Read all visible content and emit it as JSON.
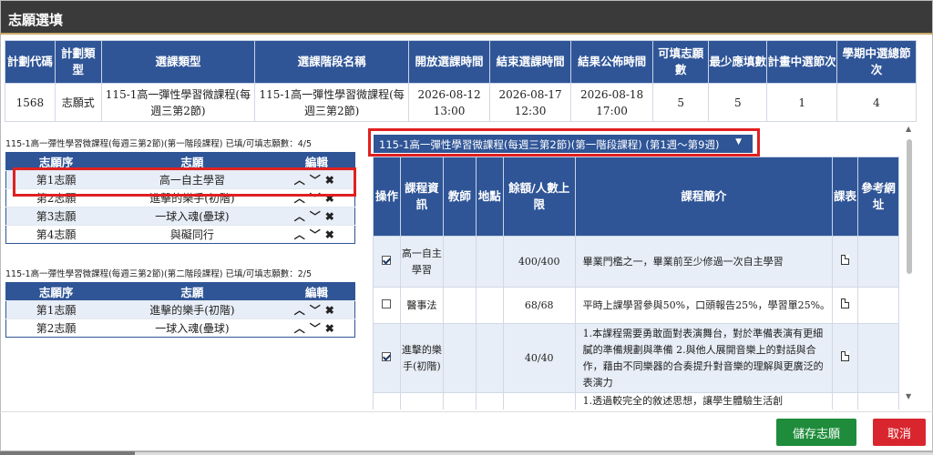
{
  "modal": {
    "title": "志願選填"
  },
  "plan": {
    "headers": [
      "計劃代碼",
      "計劃類型",
      "選課類型",
      "選課階段名稱",
      "開放選課時間",
      "結束選課時間",
      "結果公佈時間",
      "可填志願數",
      "最少應填數",
      "計畫中選節次",
      "學期中選總節次"
    ],
    "row": [
      "1568",
      "志願式",
      "115-1高一彈性學習微課程(每週三第2節)",
      "115-1高一彈性學習微課程(每週三第2節)",
      "2026-08-12 13:00",
      "2026-08-17 12:30",
      "2026-08-18 17:00",
      "5",
      "5",
      "1",
      "4"
    ]
  },
  "wishlist1": {
    "caption": "115-1高一彈性學習微課程(每週三第2節)(第一階段課程) 已填/可填志願數：4/5",
    "headers": [
      "志願序",
      "志願",
      "編輯"
    ],
    "rows": [
      {
        "order": "第1志願",
        "course": "高一自主學習"
      },
      {
        "order": "第2志願",
        "course": "進擊的樂手(初階)"
      },
      {
        "order": "第3志願",
        "course": "一球入魂(壘球)"
      },
      {
        "order": "第4志願",
        "course": "與礙同行"
      }
    ]
  },
  "wishlist2": {
    "caption": "115-1高一彈性學習微課程(每週三第2節)(第二階段課程) 已填/可填志願數：2/5",
    "headers": [
      "志願序",
      "志願",
      "編輯"
    ],
    "rows": [
      {
        "order": "第1志願",
        "course": "進擊的樂手(初階)"
      },
      {
        "order": "第2志願",
        "course": "一球入魂(壘球)"
      }
    ]
  },
  "edit_icons": {
    "up": "chevron-up-icon",
    "down": "chevron-down-icon",
    "remove": "close-icon"
  },
  "phase_select": {
    "value": "115-1高一彈性學習微課程(每週三第2節)(第一階段課程) (第1週～第9週)"
  },
  "courses": {
    "headers": [
      "操作",
      "課程資訊",
      "教師",
      "地點",
      "餘額/人數上限",
      "課程簡介",
      "課表",
      "參考網址"
    ],
    "rows": [
      {
        "checked": true,
        "name": "高一自主學習",
        "teacher": "",
        "location": "",
        "quota": "400/400",
        "intro": "畢業門檻之一，畢業前至少修過一次自主學習"
      },
      {
        "checked": false,
        "name": "醫事法",
        "teacher": "",
        "location": "",
        "quota": "68/68",
        "intro": "平時上課學習參與50%，口頭報告25%，學習單25%。"
      },
      {
        "checked": true,
        "name": "進擊的樂手(初階)",
        "teacher": "",
        "location": "",
        "quota": "40/40",
        "intro": "1.本課程需要勇敢面對表演舞台，對於準備表演有更細膩的準備規劃與準備 2.與他人展開音樂上的對話與合作，藉由不同樂器的合奏提升對音樂的理解與更廣泛的表演力"
      },
      {
        "checked": false,
        "name": "",
        "teacher": "",
        "location": "",
        "quota": "",
        "intro": "1.透過較完全的敘述思想，讓學生體驗生活創"
      }
    ]
  },
  "buttons": {
    "save": "儲存志願",
    "cancel": "取消"
  },
  "colors": {
    "header_blue": "#2f5597",
    "highlight_red": "#e02020",
    "save_green": "#1e8c3a",
    "cancel_red": "#d9262e"
  }
}
